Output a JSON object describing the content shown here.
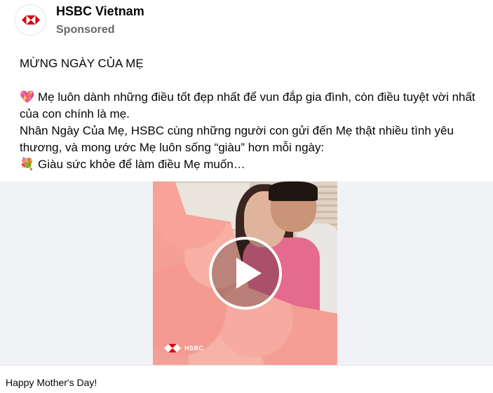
{
  "header": {
    "page_name": "HSBC Vietnam",
    "sponsored_label": "Sponsored"
  },
  "post": {
    "title": "MỪNG NGÀY CỦA MẸ",
    "lines": [
      "Mẹ luôn dành những điều tốt đẹp nhất để vun đắp gia đình, còn điều tuyệt vời nhất của con chính là mẹ.",
      "Nhân Ngày Của Mẹ, HSBC cùng những người con gửi đến Mẹ thật nhiều tình yêu thương, và mong ước Mẹ luôn sống “giàu” hơn mỗi ngày:",
      "Giàu sức khỏe để làm điều Mẹ muốn…"
    ],
    "emoji_1": "💖",
    "emoji_2": "💐"
  },
  "media": {
    "brand_text": "HSBC",
    "play_icon": "play-icon"
  },
  "caption": {
    "text": "Happy Mother's Day!"
  },
  "colors": {
    "hsbc_red": "#db0011",
    "petal_pink": "#f4a096"
  }
}
